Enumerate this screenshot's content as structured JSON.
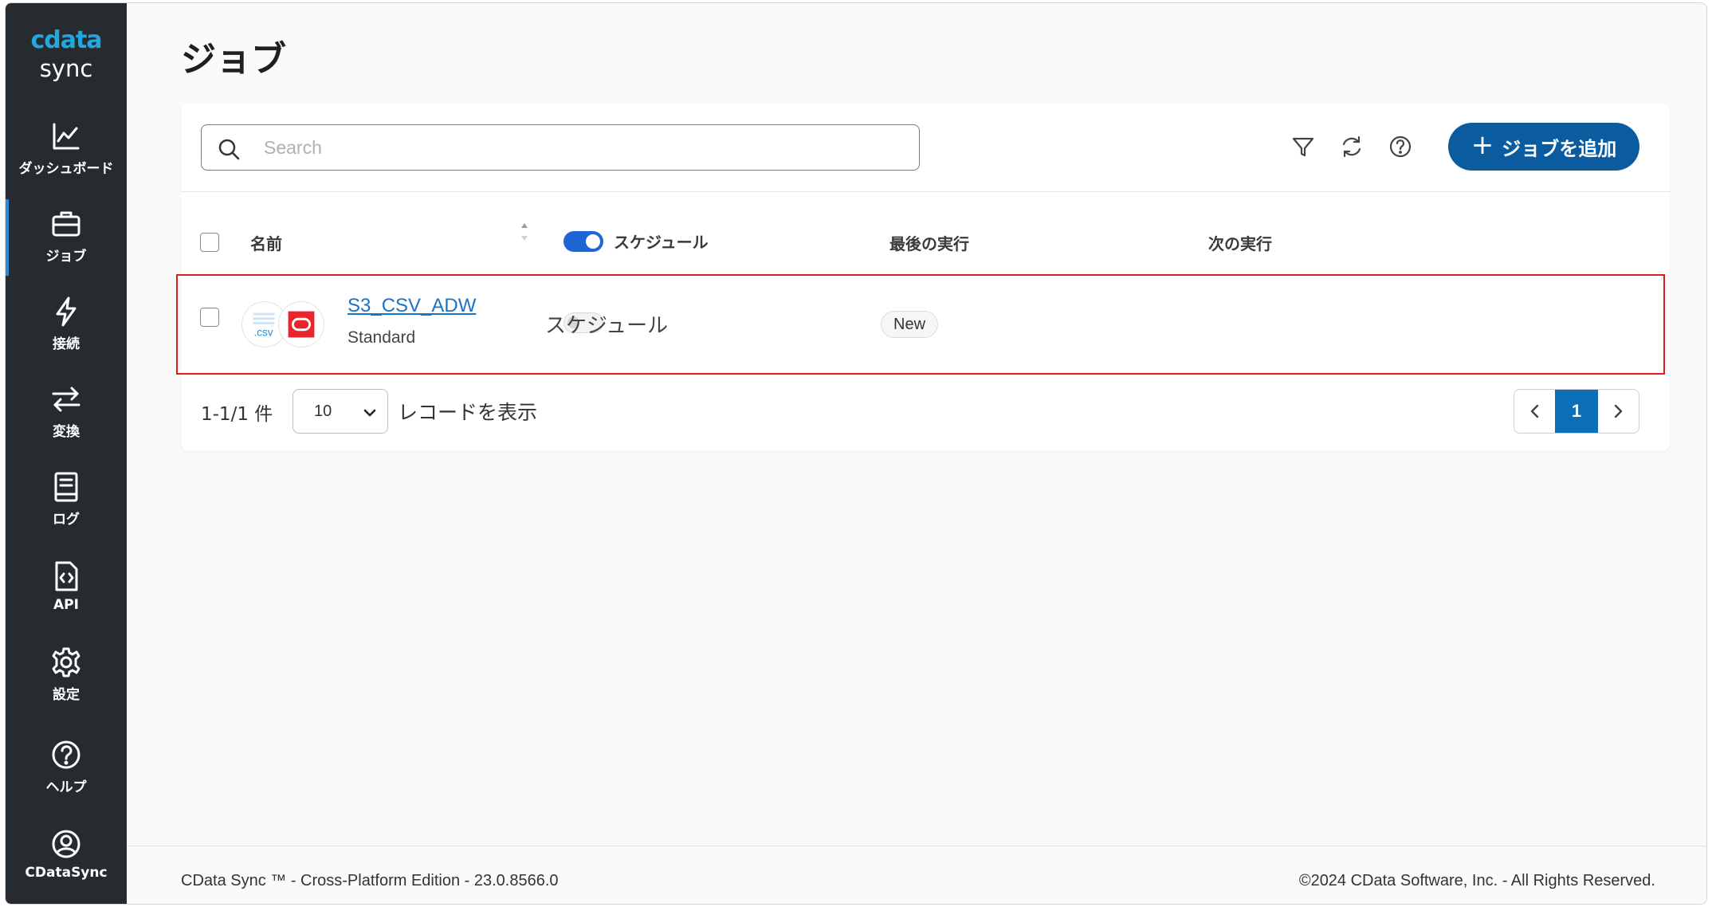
{
  "app": {
    "logo_brand": "cdata",
    "logo_product": "sync"
  },
  "sidebar": {
    "items": [
      {
        "label": "ダッシュボード",
        "icon": "chart-line-icon",
        "active": false
      },
      {
        "label": "ジョブ",
        "icon": "briefcase-icon",
        "active": true
      },
      {
        "label": "接続",
        "icon": "lightning-icon",
        "active": false
      },
      {
        "label": "変換",
        "icon": "arrows-exchange-icon",
        "active": false
      },
      {
        "label": "ログ",
        "icon": "book-icon",
        "active": false
      },
      {
        "label": "API",
        "icon": "code-file-icon",
        "active": false
      },
      {
        "label": "設定",
        "icon": "gear-icon",
        "active": false
      },
      {
        "label": "ヘルプ",
        "icon": "help-circle-icon",
        "active": false
      },
      {
        "label": "CDataSync",
        "icon": "user-circle-icon",
        "active": false
      }
    ]
  },
  "page": {
    "title": "ジョブ"
  },
  "toolbar": {
    "search_placeholder": "Search",
    "search_value": "",
    "add_label": "ジョブを追加",
    "add_icon": "plus-icon"
  },
  "table": {
    "headers": {
      "name": "名前",
      "schedule": "スケジュール",
      "last_run": "最後の実行",
      "next_run": "次の実行"
    },
    "rows": [
      {
        "name": "S3_CSV_ADW",
        "type": "Standard",
        "schedule_label": "スケジュール",
        "schedule_enabled": false,
        "last_run": "New",
        "next_run": "",
        "source_icon_text": ".csv",
        "source_icon": "csv-icon",
        "destination_icon": "oracle-icon"
      }
    ]
  },
  "pagination": {
    "count_text": "1-1/1 件",
    "page_size": "10",
    "records_label": "レコードを表示",
    "current_page": "1"
  },
  "footer": {
    "left": "CData Sync ™ - Cross-Platform Edition - 23.0.8566.0",
    "right": "©2024 CData Software, Inc. - All Rights Reserved."
  },
  "colors": {
    "sidebar_bg": "#262b30",
    "accent": "#0b5c9e",
    "link": "#1a73c4",
    "toggle_on": "#1e66d6",
    "highlight": "#e01b1b",
    "oracle": "#e8242c"
  }
}
